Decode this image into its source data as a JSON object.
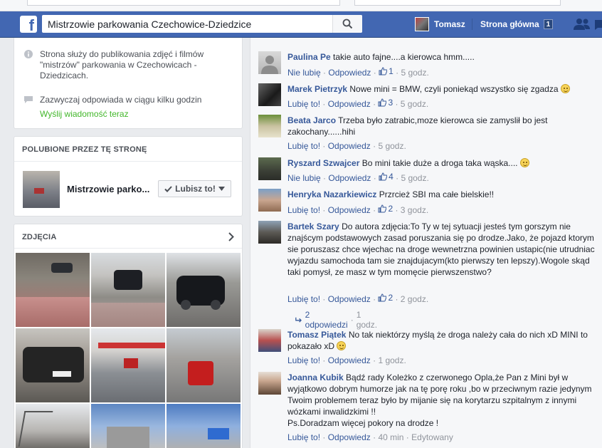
{
  "header": {
    "logo": "f",
    "search_value": "Mistrzowie parkowania Czechowice-Dziedzice",
    "user_name": "Tomasz",
    "home_label": "Strona główna",
    "home_badge": "1",
    "brand_color": "#4267b2"
  },
  "about": {
    "description": "Strona służy do publikowania zdjęć i filmów \"mistrzów\" parkowania w Czechowicach - Dziedzicach.",
    "response_time": "Zazwyczaj odpowiada w ciągu kilku godzin",
    "message_link": "Wyślij wiadomość teraz"
  },
  "liked_by": {
    "heading": "POLUBIONE PRZEZ TĘ STRONĘ",
    "page_name": "Mistrzowie parko...",
    "button_label": "Lubisz to!"
  },
  "photos": {
    "heading": "ZDJĘCIA"
  },
  "comments": [
    {
      "name": "Paulina Pe",
      "text": "takie auto fajne....a kierowca hmm.....",
      "action": "Nie lubię",
      "reply": "Odpowiedz",
      "likes": "1",
      "time": "5 godz.",
      "edited": ""
    },
    {
      "name": "Marek Pietrzyk",
      "text": "Nowe mini = BMW, czyli poniekąd wszystko się zgadza",
      "action": "Lubię to!",
      "reply": "Odpowiedz",
      "likes": "3",
      "time": "5 godz.",
      "edited": ""
    },
    {
      "name": "Beata Jarco",
      "text": "Trzeba było zatrabic,moze kierowca sie zamyslił bo jest zakochany......hihi",
      "action": "Lubię to!",
      "reply": "Odpowiedz",
      "likes": "",
      "time": "5 godz.",
      "edited": ""
    },
    {
      "name": "Ryszard Szwajcer",
      "text": "Bo mini takie duże a droga taka wąska....",
      "action": "Nie lubię",
      "reply": "Odpowiedz",
      "likes": "4",
      "time": "5 godz.",
      "edited": ""
    },
    {
      "name": "Henryka Nazarkiewicz",
      "text": "Przrcież SBI ma całe bielskie!!",
      "action": "Lubię to!",
      "reply": "Odpowiedz",
      "likes": "2",
      "time": "3 godz.",
      "edited": ""
    },
    {
      "name": "Bartek Szary",
      "text": "Do autora zdjęcia:To Ty w tej sytuacji jesteś tym gorszym nie znajścym podstawowych zasad poruszania się po drodze.Jako, że pojazd ktorym sie poruszasz chce wjechac na droge wewnetrzna powinien ustapic(nie utrudniac wyjazdu samochoda tam sie znajdujacym(kto pierwszy ten lepszy).Wogole skąd taki pomysł, ze masz w tym momęcie pierwszenstwo?",
      "action": "Lubię to!",
      "reply": "Odpowiedz",
      "likes": "2",
      "time": "2 godz.",
      "edited": "",
      "replies": "2 odpowiedzi",
      "replies_time": "1 godz."
    },
    {
      "name": "Tomasz Piątek",
      "text": "No tak niektórzy myślą że droga należy cała do nich xD MINI to pokazało xD",
      "action": "Lubię to!",
      "reply": "Odpowiedz",
      "likes": "",
      "time": "1 godz.",
      "edited": ""
    },
    {
      "name": "Joanna Kubik",
      "text": "Bądź rady Koleżko z czerwonego Opla,że Pan z Mini był w wyjątkowo dobrym humorze jak na tę porę roku ,bo w przeciwnym razie jedynym Twoim problemem teraz było by mijanie się na korytarzu szpitalnym z innymi wózkami inwalidzkimi !!",
      "text2": "Ps.Doradzam więcej pokory na drodze !",
      "action": "Lubię to!",
      "reply": "Odpowiedz",
      "likes": "",
      "time": "40 min",
      "edited": "Edytowany"
    }
  ]
}
